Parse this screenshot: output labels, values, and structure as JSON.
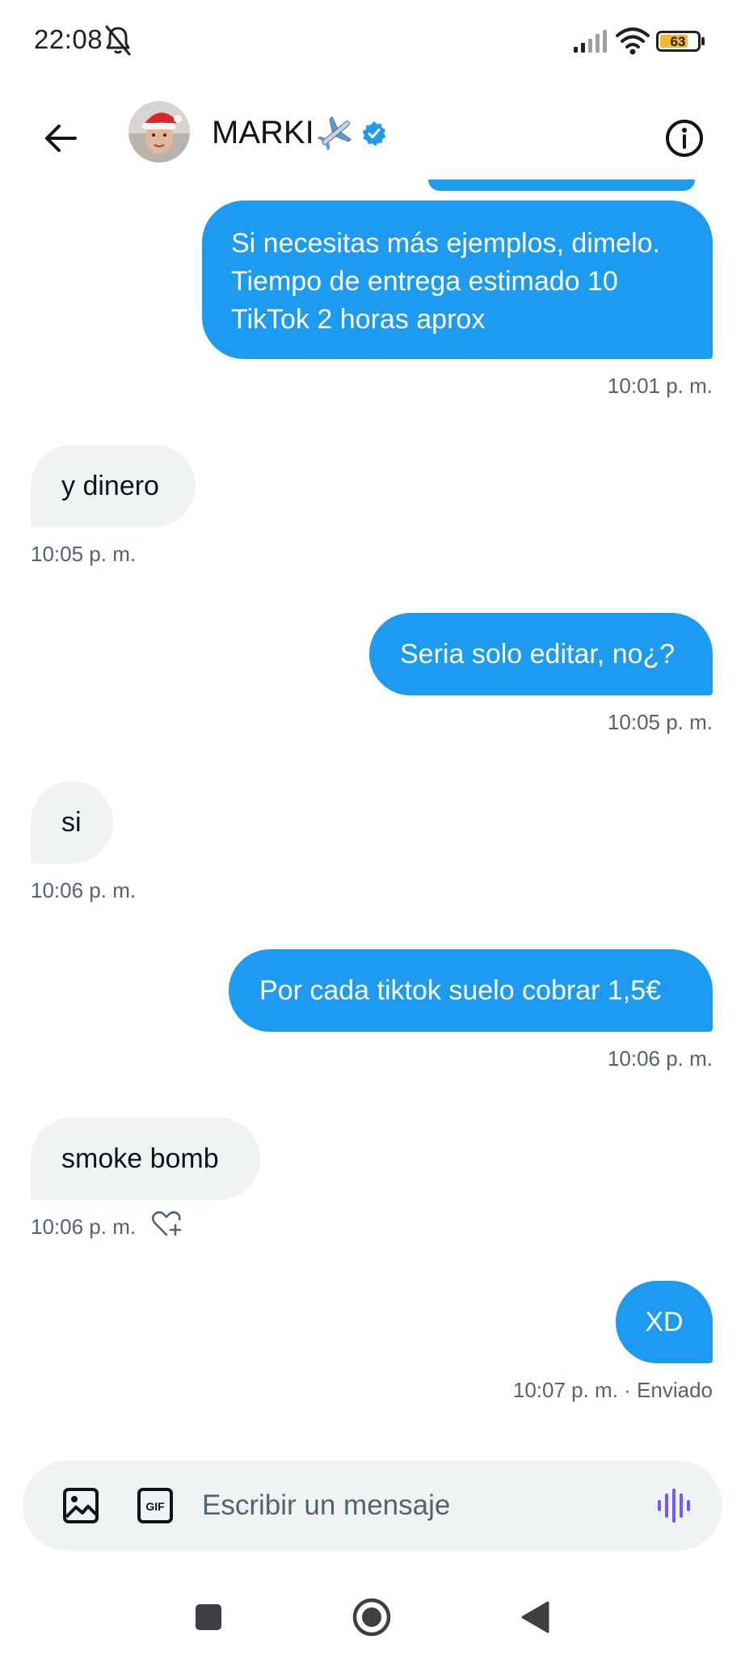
{
  "status_bar": {
    "time": "22:08",
    "battery_level": "63",
    "icons": [
      "bell-muted-icon",
      "signal-icon",
      "wifi-icon",
      "battery-icon"
    ]
  },
  "header": {
    "back_icon": "arrow-left-icon",
    "contact_name": "MARKI",
    "name_emoji": "airplane-icon",
    "verified_icon": "verified-badge-icon",
    "info_icon": "info-icon",
    "accent_color": "#1d9bf0"
  },
  "messages": [
    {
      "direction": "sent",
      "lines": [
        "Si necesitas más ejemplos, dimelo.",
        "Tiempo de entrega estimado 10",
        "TikTok 2 horas aprox"
      ],
      "time": "10:01 p. m."
    },
    {
      "direction": "received",
      "text": "y dinero",
      "time": "10:05 p. m."
    },
    {
      "direction": "sent",
      "text": "Seria solo editar, no¿?",
      "time": "10:05 p. m."
    },
    {
      "direction": "received",
      "text": "si",
      "time": "10:06 p. m."
    },
    {
      "direction": "sent",
      "text": "Por cada tiktok suelo cobrar 1,5€",
      "time": "10:06 p. m."
    },
    {
      "direction": "received",
      "text": "smoke bomb",
      "time": "10:06 p. m.",
      "reaction_icon": "heart-add-icon"
    },
    {
      "direction": "sent",
      "text": "XD",
      "time": "10:07 p. m. · Enviado"
    }
  ],
  "composer": {
    "placeholder": "Escribir un mensaje",
    "value": "",
    "image_icon": "image-icon",
    "gif_label": "GIF",
    "voice_icon": "voice-wave-icon",
    "voice_color": "#7856ff"
  },
  "nav_bar": {
    "icons": [
      "recents-square-icon",
      "home-circle-icon",
      "back-triangle-icon"
    ]
  },
  "colors": {
    "sent_bubble": "#1d9bf0",
    "received_bubble": "#eff3f4",
    "timestamp": "#536471"
  }
}
